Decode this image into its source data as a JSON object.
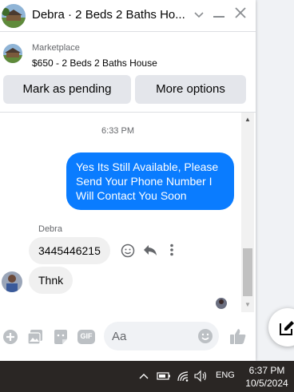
{
  "header": {
    "title": "Debra · 2 Beds 2 Baths Ho...",
    "avatar_icon": "house-photo-avatar",
    "chevron_icon": "chevron-down-icon",
    "minimize_icon": "minimize-icon",
    "close_icon": "close-icon"
  },
  "marketplace": {
    "label": "Marketplace",
    "listing_title": "$650 - 2 Beds 2 Baths House",
    "mark_pending_label": "Mark as pending",
    "more_options_label": "More options"
  },
  "messages": {
    "timestamp": "6:33 PM",
    "outgoing": [
      {
        "text": "Yes Its Still Available, Please Send Your Phone Number I Will Contact You Soon"
      }
    ],
    "sender_name": "Debra",
    "incoming": [
      {
        "text": "3445446215"
      },
      {
        "text": "Thnk"
      }
    ]
  },
  "composer": {
    "placeholder": "Aa",
    "icons": [
      "add-icon",
      "photo-icon",
      "sticker-icon",
      "gif-icon",
      "emoji-icon",
      "like-icon"
    ],
    "gif_label": "GIF"
  },
  "taskbar": {
    "language": "ENG",
    "time": "6:37 PM",
    "date": "10/5/2024"
  },
  "colors": {
    "messenger_blue": "#0a7cff",
    "bubble_gray": "#f0f0f0",
    "button_gray": "#e4e6eb",
    "taskbar": "#2a2624"
  }
}
